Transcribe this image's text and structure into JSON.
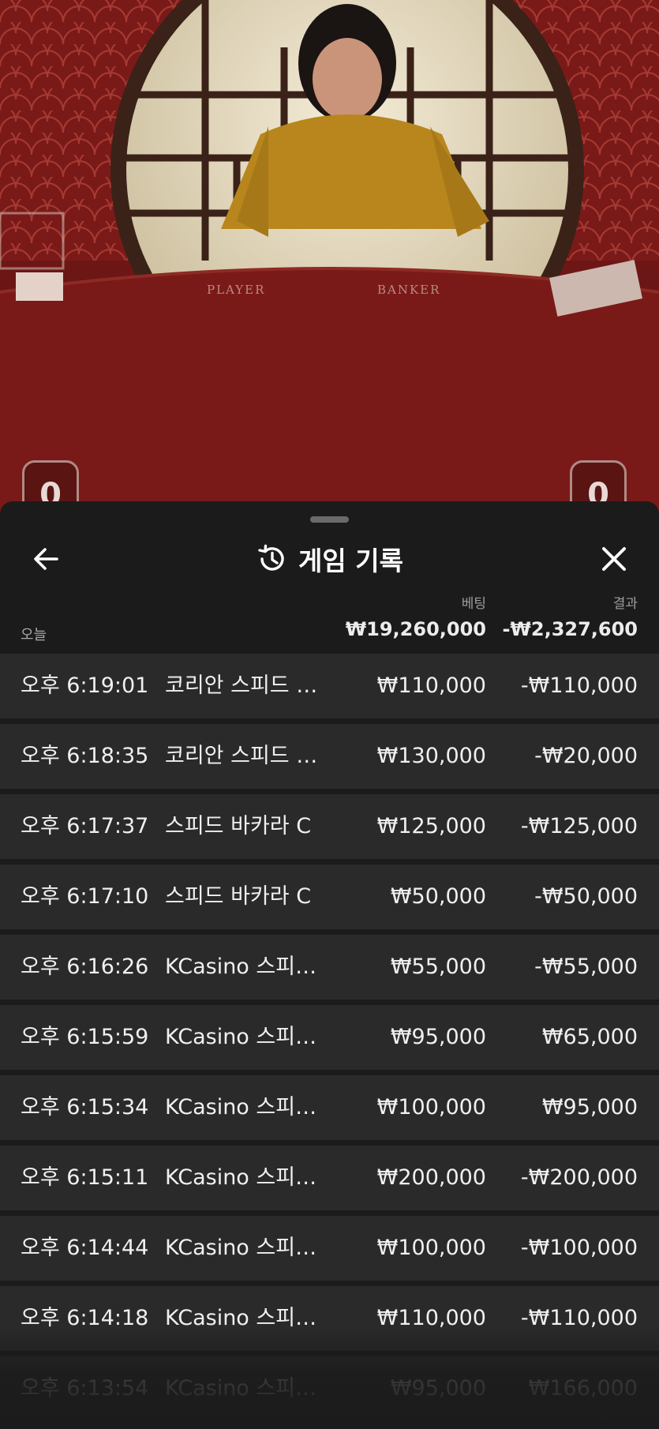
{
  "video": {
    "table_labels": {
      "player": "PLAYER",
      "banker": "BANKER"
    },
    "player_score": "0",
    "banker_score": "0"
  },
  "sheet": {
    "title": "게임 기록",
    "icons": {
      "back": "arrow-left-icon",
      "history": "history-icon",
      "close": "close-icon"
    },
    "columns": {
      "bet": "베팅",
      "result": "결과"
    },
    "summary": {
      "label": "오늘",
      "total_bet": "₩19,260,000",
      "total_result": "-₩2,327,600"
    },
    "rows": [
      {
        "time": "오후 6:19:01",
        "game": "코리안 스피드 바…",
        "bet": "₩110,000",
        "result": "-₩110,000"
      },
      {
        "time": "오후 6:18:35",
        "game": "코리안 스피드 바…",
        "bet": "₩130,000",
        "result": "-₩20,000"
      },
      {
        "time": "오후 6:17:37",
        "game": "스피드 바카라 C",
        "bet": "₩125,000",
        "result": "-₩125,000"
      },
      {
        "time": "오후 6:17:10",
        "game": "스피드 바카라 C",
        "bet": "₩50,000",
        "result": "-₩50,000"
      },
      {
        "time": "오후 6:16:26",
        "game": "KCasino 스피…",
        "bet": "₩55,000",
        "result": "-₩55,000"
      },
      {
        "time": "오후 6:15:59",
        "game": "KCasino 스피…",
        "bet": "₩95,000",
        "result": "₩65,000"
      },
      {
        "time": "오후 6:15:34",
        "game": "KCasino 스피…",
        "bet": "₩100,000",
        "result": "₩95,000"
      },
      {
        "time": "오후 6:15:11",
        "game": "KCasino 스피…",
        "bet": "₩200,000",
        "result": "-₩200,000"
      },
      {
        "time": "오후 6:14:44",
        "game": "KCasino 스피…",
        "bet": "₩100,000",
        "result": "-₩100,000"
      },
      {
        "time": "오후 6:14:18",
        "game": "KCasino 스피…",
        "bet": "₩110,000",
        "result": "-₩110,000"
      },
      {
        "time": "오후 6:13:54",
        "game": "KCasino 스피…",
        "bet": "₩95,000",
        "result": "₩166,000"
      }
    ]
  }
}
